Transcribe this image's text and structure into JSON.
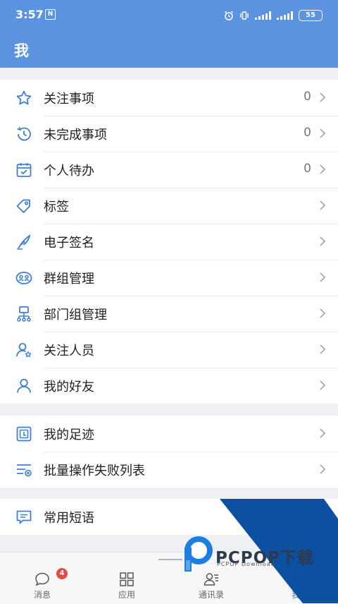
{
  "status_bar": {
    "time": "3:57",
    "nfc": "N",
    "battery": "55"
  },
  "header": {
    "title": "我"
  },
  "menu_groups": [
    {
      "items": [
        {
          "icon": "star-icon",
          "label": "关注事项",
          "count": "0"
        },
        {
          "icon": "history-icon",
          "label": "未完成事项",
          "count": "0"
        },
        {
          "icon": "calendar-check-icon",
          "label": "个人待办",
          "count": "0"
        },
        {
          "icon": "tag-icon",
          "label": "标签"
        },
        {
          "icon": "signature-feather-icon",
          "label": "电子签名"
        },
        {
          "icon": "group-icon",
          "label": "群组管理"
        },
        {
          "icon": "org-chart-icon",
          "label": "部门组管理"
        },
        {
          "icon": "followed-person-icon",
          "label": "关注人员"
        },
        {
          "icon": "person-icon",
          "label": "我的好友"
        }
      ]
    },
    {
      "items": [
        {
          "icon": "footprint-icon",
          "label": "我的足迹"
        },
        {
          "icon": "batch-fail-list-icon",
          "label": "批量操作失败列表"
        }
      ]
    },
    {
      "items": [
        {
          "icon": "message-phrase-icon",
          "label": "常用短语"
        }
      ]
    }
  ],
  "bottom_nav": {
    "tabs": [
      {
        "icon": "chat-bubble-icon",
        "label": "消息",
        "badge": "4"
      },
      {
        "icon": "apps-grid-icon",
        "label": "应用"
      },
      {
        "icon": "contacts-icon",
        "label": "通讯录"
      },
      {
        "icon": "me-icon",
        "label": "我"
      }
    ]
  },
  "watermark": {
    "brand": "PCPOP下载",
    "sub": "PCPOP Download"
  },
  "colors": {
    "primary": "#5b93e0",
    "icon": "#3d7ed8",
    "badge": "#e34a48",
    "watermark_blue": "#0d4fa0"
  }
}
